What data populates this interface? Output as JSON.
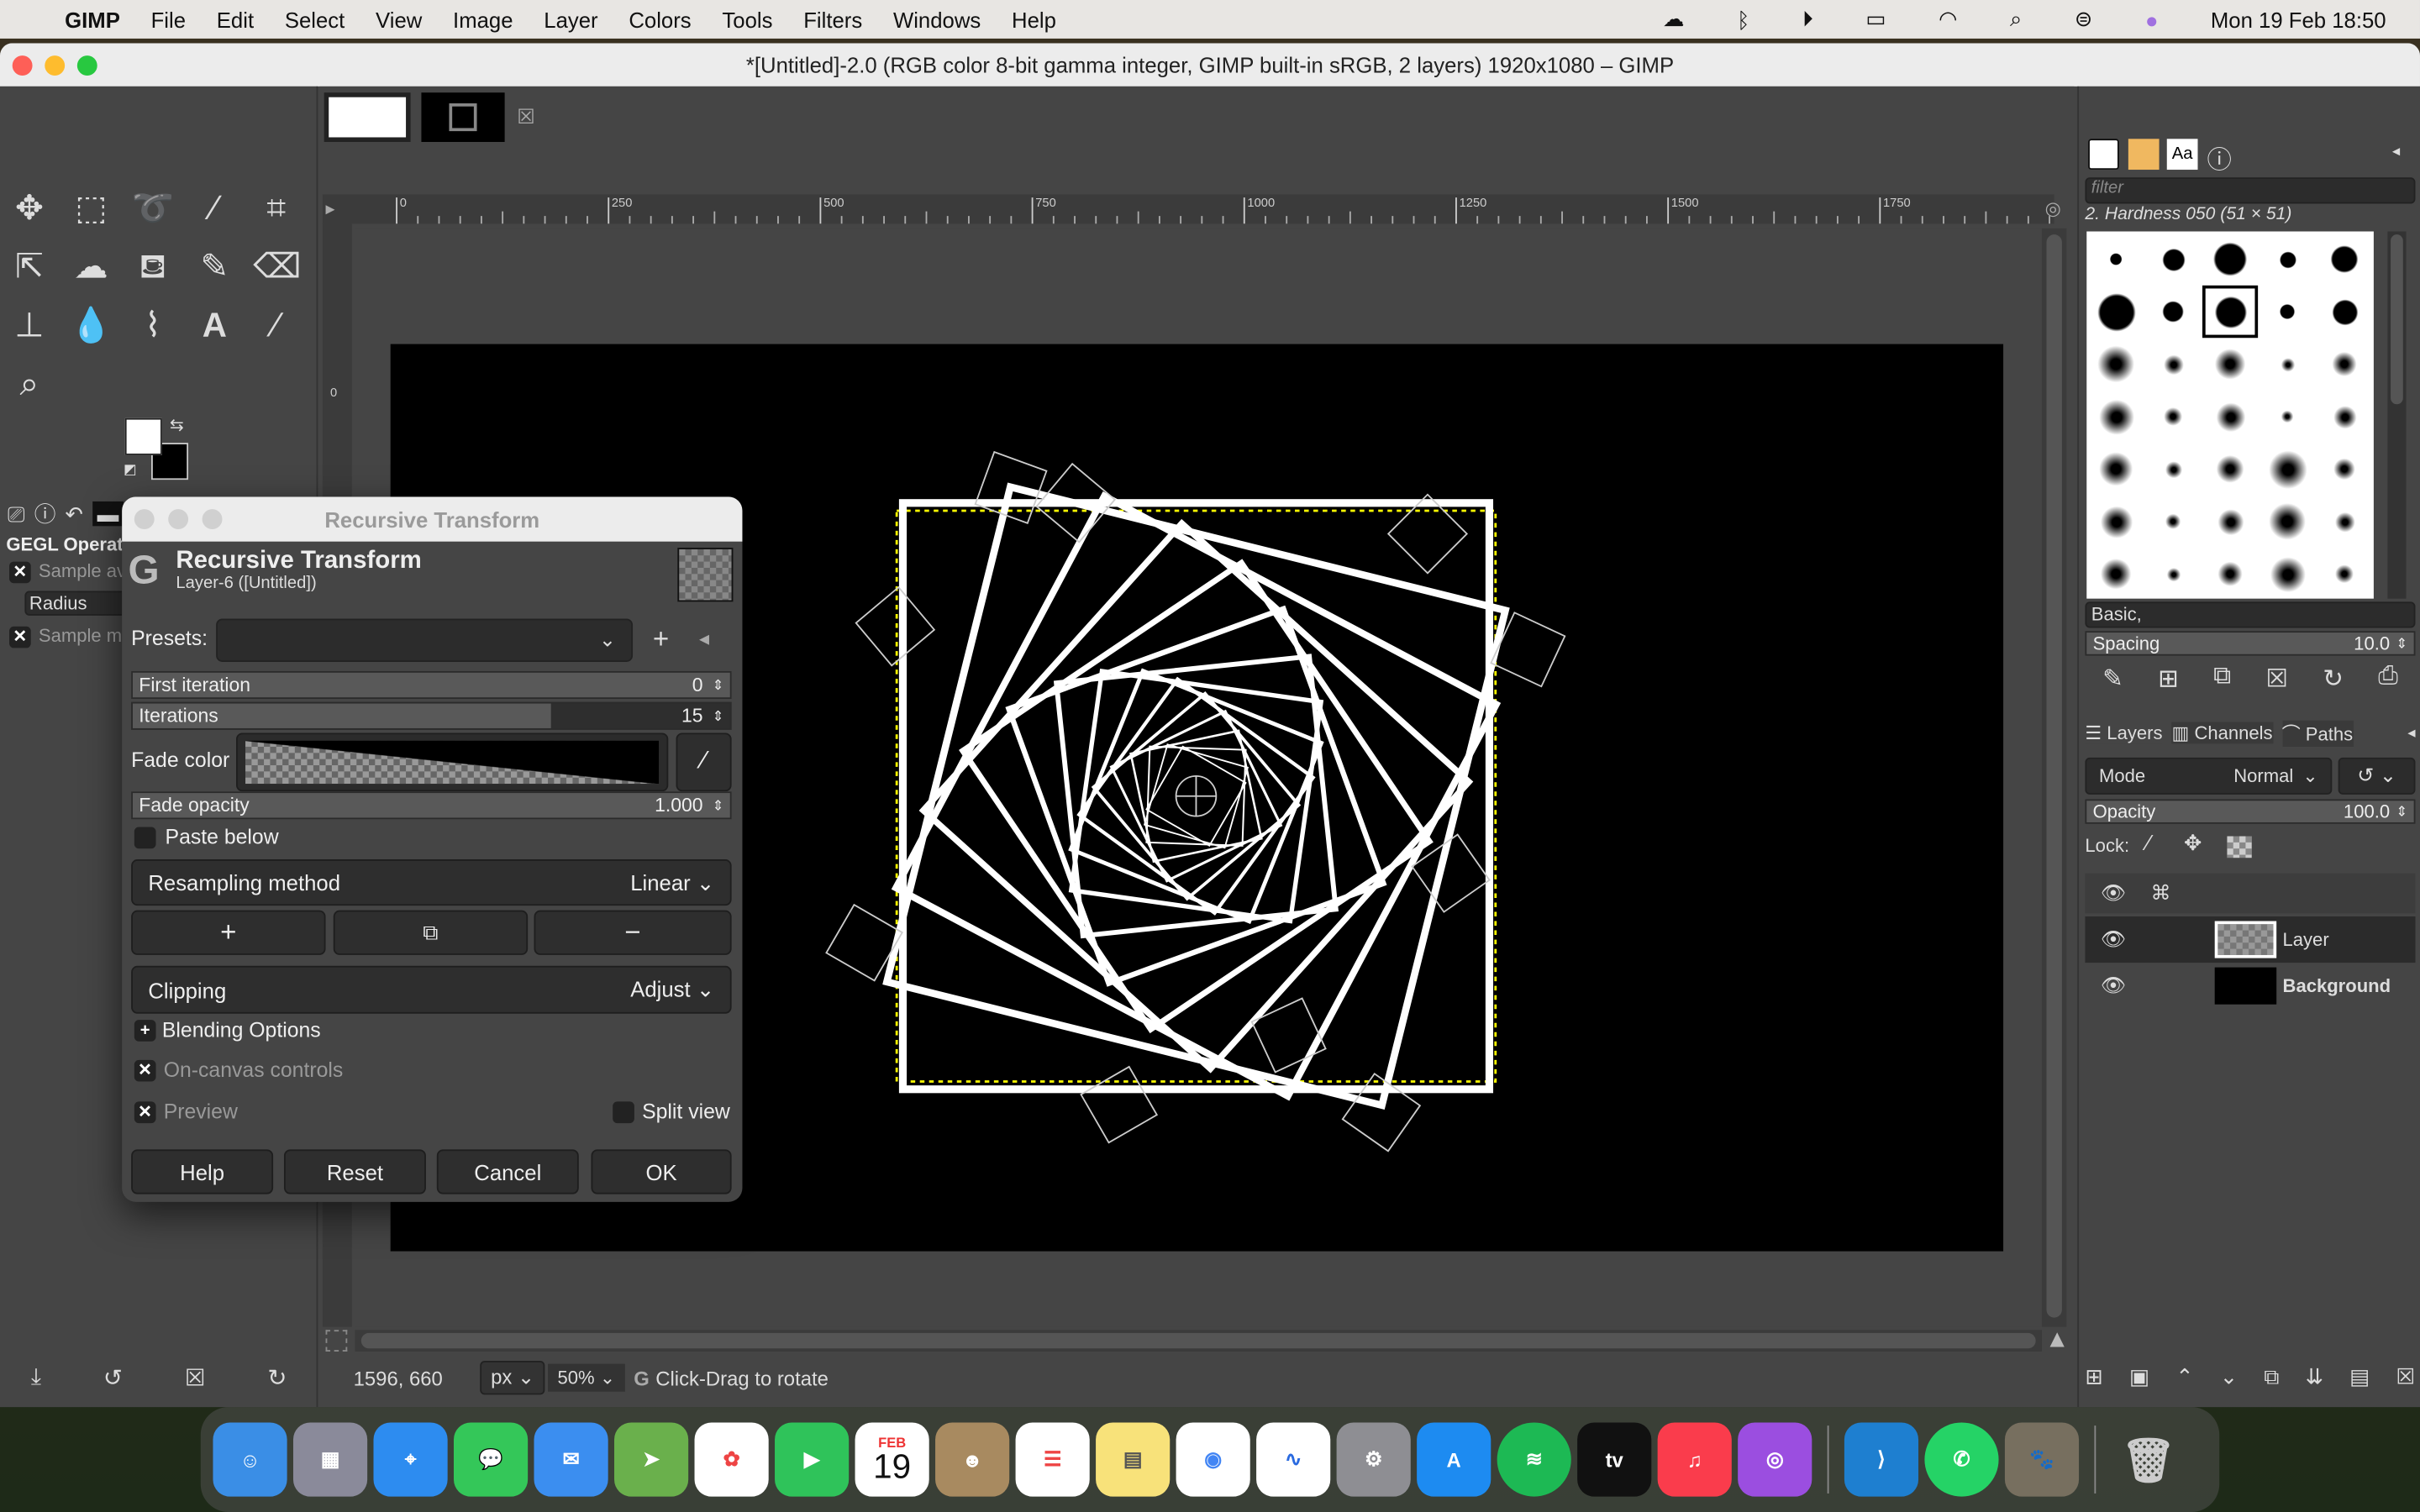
{
  "menubar": {
    "app": "GIMP",
    "items": [
      "File",
      "Edit",
      "Select",
      "View",
      "Image",
      "Layer",
      "Colors",
      "Tools",
      "Filters",
      "Windows",
      "Help"
    ],
    "clock": "Mon 19 Feb  18:50"
  },
  "window": {
    "title": "*[Untitled]-2.0 (RGB color 8-bit gamma integer, GIMP built-in sRGB, 2 layers) 1920x1080 – GIMP"
  },
  "toolbox": {
    "gegl_title": "GEGL Operation",
    "sample_avg": "Sample av",
    "radius": "Radius",
    "sample_merged": "Sample me"
  },
  "ruler": {
    "ticks": [
      "0",
      "250",
      "500",
      "750",
      "1000",
      "1250",
      "1500",
      "1750"
    ],
    "vtick": "0"
  },
  "statusbar": {
    "coords": "1596, 660",
    "unit": "px",
    "zoom": "50%",
    "message": "Click-Drag to rotate"
  },
  "dialog": {
    "window_title": "Recursive Transform",
    "heading": "Recursive Transform",
    "subheading": "Layer-6 ([Untitled])",
    "presets_label": "Presets:",
    "presets_value": "",
    "first_iteration_label": "First iteration",
    "first_iteration_value": "0",
    "iterations_label": "Iterations",
    "iterations_value": "15",
    "iterations_fraction": 0.7,
    "fade_color_label": "Fade color",
    "fade_opacity_label": "Fade opacity",
    "fade_opacity_value": "1.000",
    "paste_below_label": "Paste below",
    "paste_below_checked": false,
    "resampling_label": "Resampling method",
    "resampling_value": "Linear",
    "clipping_label": "Clipping",
    "clipping_value": "Adjust",
    "blending_label": "Blending Options",
    "on_canvas_label": "On-canvas controls",
    "on_canvas_checked": true,
    "preview_label": "Preview",
    "preview_checked": true,
    "split_view_label": "Split view",
    "split_view_checked": false,
    "buttons": {
      "help": "Help",
      "reset": "Reset",
      "cancel": "Cancel",
      "ok": "OK"
    }
  },
  "brushes": {
    "filter_placeholder": "filter",
    "selected": "2. Hardness 050 (51 × 51)",
    "tag": "Basic,",
    "spacing_label": "Spacing",
    "spacing_value": "10.0",
    "font_tab": "Aa"
  },
  "layers": {
    "tabs": [
      "Layers",
      "Channels",
      "Paths"
    ],
    "mode_label": "Mode",
    "mode_value": "Normal",
    "opacity_label": "Opacity",
    "opacity_value": "100.0",
    "lock_label": "Lock:",
    "items": [
      {
        "name": "Layer",
        "active": true
      },
      {
        "name": "Background",
        "active": false
      }
    ]
  },
  "dock": {
    "calendar_month": "FEB",
    "calendar_day": "19"
  }
}
